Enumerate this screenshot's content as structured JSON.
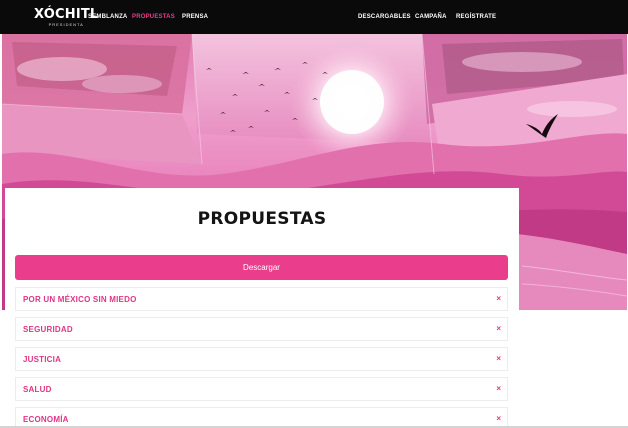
{
  "header": {
    "logo_text": "XÓCHITL",
    "logo_subtext": "PRESIDENTA",
    "nav_left": [
      "SEMBLANZA",
      "PROPUESTAS",
      "PRENSA"
    ],
    "nav_right": [
      "DESCARGABLES",
      "CAMPAÑA",
      "REGÍSTRATE"
    ],
    "active_item": "PROPUESTAS"
  },
  "main": {
    "title": "PROPUESTAS",
    "download_label": "Descargar",
    "accordion": [
      {
        "label": "POR UN MÉXICO SIN MIEDO",
        "icon": "×"
      },
      {
        "label": "SEGURIDAD",
        "icon": "×"
      },
      {
        "label": "JUSTICIA",
        "icon": "×"
      },
      {
        "label": "SALUD",
        "icon": "×"
      },
      {
        "label": "ECONOMÍA",
        "icon": "×"
      }
    ]
  },
  "colors": {
    "accent": "#ea3d8c",
    "nav_bg": "#0a0a0a",
    "label_pink": "#e03585"
  }
}
